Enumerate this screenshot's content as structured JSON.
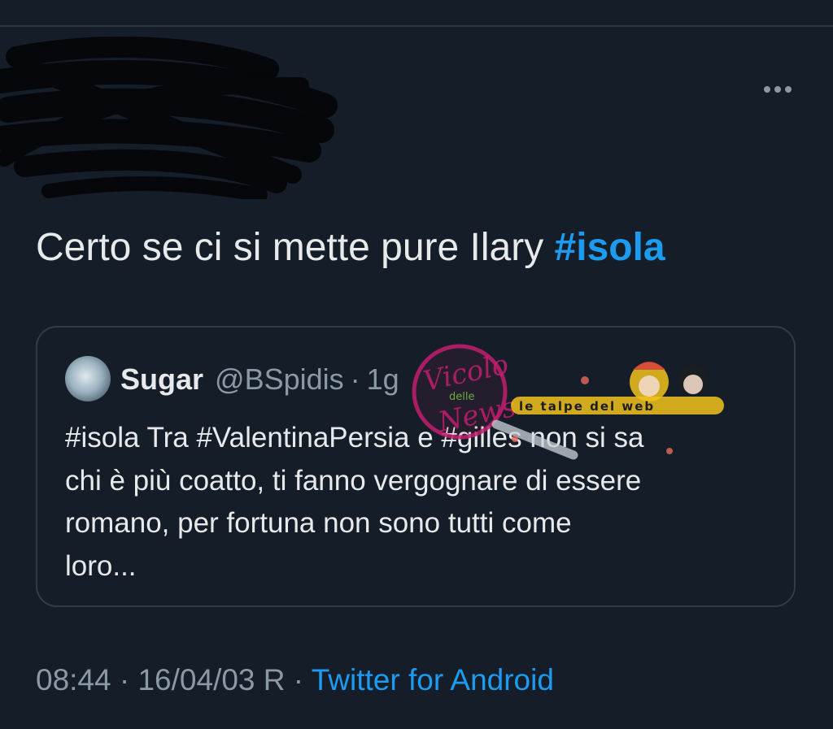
{
  "tweet": {
    "text_prefix": "Certo se ci si mette pure Ilary ",
    "text_hashtag": "#isola",
    "more_icon": "more-horizontal-icon"
  },
  "quote": {
    "name": "Sugar",
    "handle": "@BSpidis",
    "separator": "·",
    "time": "1g",
    "lines": [
      "#isola Tra #ValentinaPersia  e #gilles non si sa",
      "chi è più coatto, ti fanno vergognare di essere",
      "romano, per fortuna non sono tutti come",
      "loro..."
    ]
  },
  "meta": {
    "time": "08:44",
    "sep1": " · ",
    "date": "16/04/03 R",
    "sep2": " · ",
    "source": "Twitter for Android"
  },
  "watermarks": {
    "vicolo": [
      "Vicolo",
      "delle",
      "News"
    ],
    "talpe": "le talpe del web"
  },
  "colors": {
    "background": "#151d28",
    "text": "#e7e9ea",
    "muted": "#8b98a5",
    "accent": "#1d9bf0",
    "border": "#323c49",
    "watermark_pink": "#c21d6e",
    "watermark_yellow": "#f2c21b"
  }
}
